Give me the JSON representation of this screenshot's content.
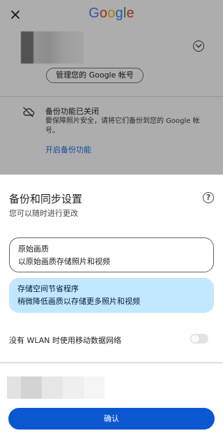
{
  "background": {
    "logo_text": "Google",
    "logo_letters": [
      {
        "ch": "G",
        "color": "#4285F4"
      },
      {
        "ch": "o",
        "color": "#EA4335"
      },
      {
        "ch": "o",
        "color": "#FBBC05"
      },
      {
        "ch": "g",
        "color": "#4285F4"
      },
      {
        "ch": "l",
        "color": "#34A853"
      },
      {
        "ch": "e",
        "color": "#EA4335"
      }
    ],
    "manage_account_label": "管理您的 Google 帐号",
    "backup_status_title": "备份功能已关闭",
    "backup_status_desc": "要保障照片安全，请将它们备份到您的 Google 帐号。",
    "enable_backup_link": "开启备份功能",
    "icons": {
      "close": "close-icon",
      "expand": "chevron-down-icon",
      "cloud_off": "cloud-off-icon"
    }
  },
  "sheet": {
    "title": "备份和同步设置",
    "subtitle": "您可以随时进行更改",
    "help_icon": "help-icon",
    "help_glyph": "?",
    "options": [
      {
        "title": "原始画质",
        "desc": "以原始画质存储照片和视频",
        "selected": false
      },
      {
        "title": "存储空间节省程序",
        "desc": "稍微降低画质以存储更多照片和视频",
        "selected": true
      }
    ],
    "wlan_label": "没有 WLAN 时使用移动数据网络",
    "wlan_toggle_on": false,
    "confirm_label": "确认"
  },
  "colors": {
    "accent": "#0b57d0",
    "link": "#1a73e8",
    "selected_option_bg": "#c2e7ff",
    "scrim": "rgba(0,0,0,0.32)"
  }
}
